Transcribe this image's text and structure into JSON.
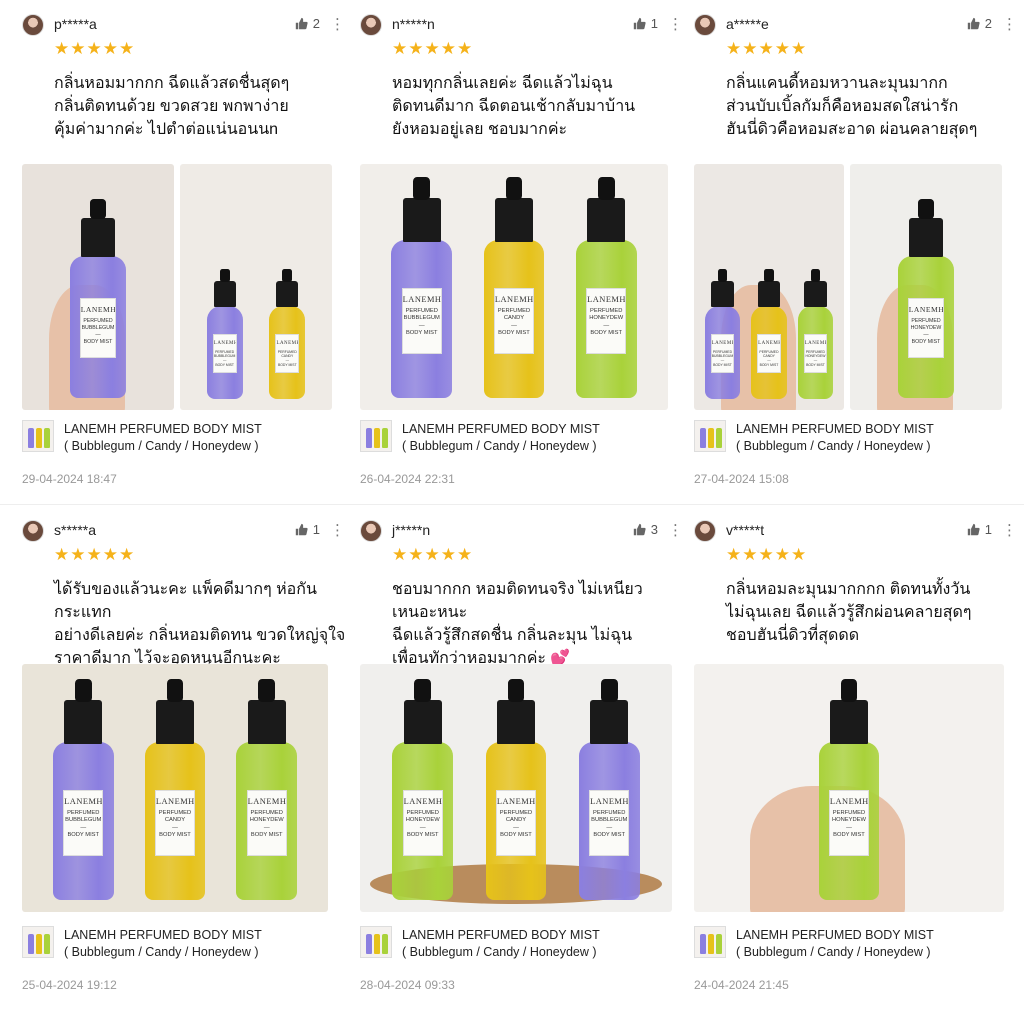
{
  "colors": {
    "star": "#f5b21a",
    "purple": "#8b7fe0",
    "yellow": "#e6c21a",
    "green": "#a9d23a"
  },
  "icons": {
    "like": "thumbs-up-icon",
    "more": "more-vertical-icon",
    "star": "star-icon"
  },
  "reviews": [
    {
      "user": "p*****a",
      "likes": "2",
      "rating": 5,
      "text": "กลิ่นหอมมากกก ฉีดแล้วสดชื่นสุดๆ\nกลิ่นติดทนด้วย ขวดสวย พกพาง่าย\nคุ้มค่ามากค่ะ ไปตำต่อแน่นอนนn",
      "product": "LANEMH PERFUMED BODY MIST",
      "variant": "( Bubblegum / Candy / Honeydew )",
      "date": "29-04-2024 18:47"
    },
    {
      "user": "n*****n",
      "likes": "1",
      "rating": 5,
      "text": "หอมทุกกลิ่นเลยค่ะ ฉีดแล้วไม่ฉุน\nติดทนดีมาก ฉีดตอนเช้ากลับมาบ้าน\nยังหอมอยู่เลย ชอบมากค่ะ",
      "product": "LANEMH PERFUMED BODY MIST",
      "variant": "( Bubblegum / Candy / Honeydew )",
      "date": "26-04-2024 22:31"
    },
    {
      "user": "a*****e",
      "likes": "2",
      "rating": 5,
      "text": "กลิ่นแคนดี้หอมหวานละมุนมากก\nส่วนบับเบิ้ลกัมก็คือหอมสดใสน่ารัก\nฮันนี่ดิวคือหอมสะอาด ผ่อนคลายสุดๆ",
      "product": "LANEMH PERFUMED BODY MIST",
      "variant": "( Bubblegum / Candy / Honeydew )",
      "date": "27-04-2024 15:08"
    },
    {
      "user": "s*****a",
      "likes": "1",
      "rating": 5,
      "text": "ได้รับของแล้วนะคะ แพ็คดีมากๆ ห่อกันกระแทก\nอย่างดีเลยค่ะ กลิ่นหอมติดทน ขวดใหญ่จุใจ\nราคาดีมาก ไว้จะอุดหนุนอีกนะคะ",
      "product": "LANEMH PERFUMED BODY MIST",
      "variant": "( Bubblegum / Candy / Honeydew )",
      "date": "25-04-2024 19:12"
    },
    {
      "user": "j*****n",
      "likes": "3",
      "rating": 5,
      "text": "ชอบมากกก หอมติดทนจริง ไม่เหนียวเหนอะหนะ\nฉีดแล้วรู้สึกสดชื่น กลิ่นละมุน ไม่ฉุน\nเพื่อนทักว่าหอมมากค่ะ 💕",
      "product": "LANEMH PERFUMED BODY MIST",
      "variant": "( Bubblegum / Candy / Honeydew )",
      "date": "28-04-2024 09:33"
    },
    {
      "user": "v*****t",
      "likes": "1",
      "rating": 5,
      "text": "กลิ่นหอมละมุนมากกกก ติดทนทั้งวัน\nไม่ฉุนเลย ฉีดแล้วรู้สึกผ่อนคลายสุดๆ\nชอบฮันนี่ดิวที่สุดดด",
      "product": "LANEMH PERFUMED BODY MIST",
      "variant": "( Bubblegum / Candy / Honeydew )",
      "date": "24-04-2024 21:45"
    }
  ],
  "bottle_labels": {
    "brand": "LANEMH",
    "bubblegum": "PERFUMED\nBUBBLEGUM\n—\nBODY MIST",
    "candy": "PERFUMED\nCANDY\n—\nBODY MIST",
    "honeydew": "PERFUMED\nHONEYDEW\n—\nBODY MIST"
  }
}
